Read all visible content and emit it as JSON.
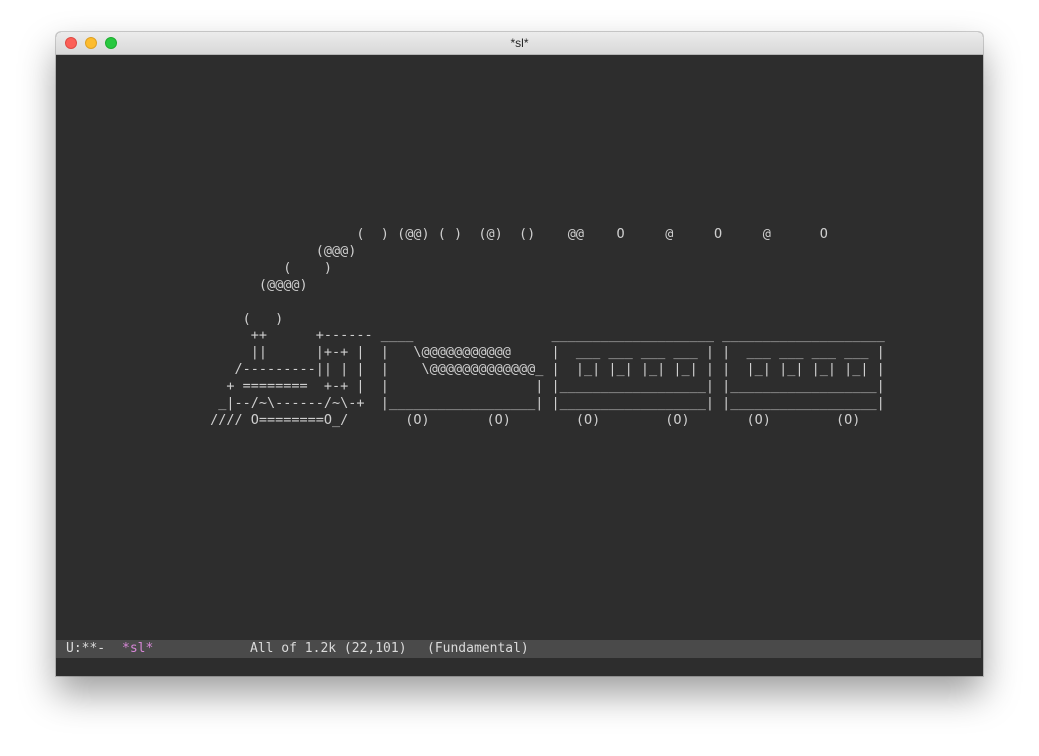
{
  "window": {
    "title": "*sl*"
  },
  "buffer": {
    "lines": [
      "                   (  ) (@@) ( )  (@)  ()    @@    O     @     O     @      O",
      "              (@@@)",
      "          (    )",
      "       (@@@@)",
      "",
      "     (   )",
      "      ++      +------ ____                 ____________________ ____________________",
      "      ||      |+-+ |  |   \\@@@@@@@@@@@     |  ___ ___ ___ ___ | |  ___ ___ ___ ___ |",
      "    /---------|| | |  |    \\@@@@@@@@@@@@@_ |  |_| |_| |_| |_| | |  |_| |_| |_| |_| |",
      "   + ========  +-+ |  |                  | |__________________| |__________________|",
      "  _|--/~\\------/~\\-+  |__________________| |__________________| |__________________|",
      " //// O========O_/       (O)       (O)        (O)        (O)       (O)        (O)"
    ]
  },
  "modeline": {
    "state": "U:**-",
    "buffer_name": "*sl*",
    "position": "All of 1.2k (22,101)",
    "major_mode": "(Fundamental)"
  }
}
